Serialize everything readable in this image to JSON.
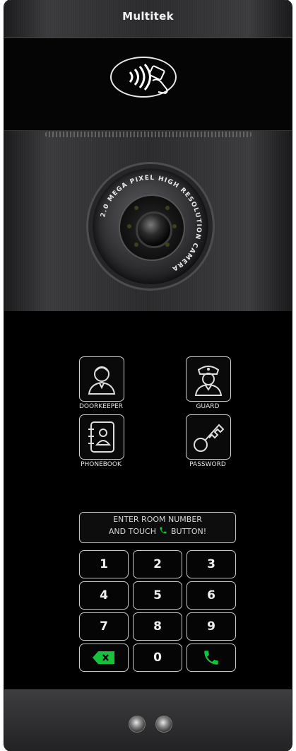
{
  "brand": "Multitek",
  "camera_ring_text": "2.0 MEGA PIXEL HIGH RESOLUTION CAMERA",
  "menu": {
    "doorkeeper_label": "DOORKEEPER",
    "guard_label": "GUARD",
    "phonebook_label": "PHONEBOOK",
    "password_label": "PASSWORD"
  },
  "message": {
    "line1": "ENTER ROOM NUMBER",
    "line2_prefix": "AND TOUCH",
    "line2_suffix": "BUTTON!"
  },
  "keypad": {
    "k1": "1",
    "k2": "2",
    "k3": "3",
    "k4": "4",
    "k5": "5",
    "k6": "6",
    "k7": "7",
    "k8": "8",
    "k9": "9",
    "k0": "0"
  },
  "icons": {
    "delete": "backspace-icon",
    "call": "phone-icon",
    "rfid": "contactless-card-icon"
  },
  "colors": {
    "accent_green": "#17c23a",
    "outline": "#cfcfcf"
  }
}
